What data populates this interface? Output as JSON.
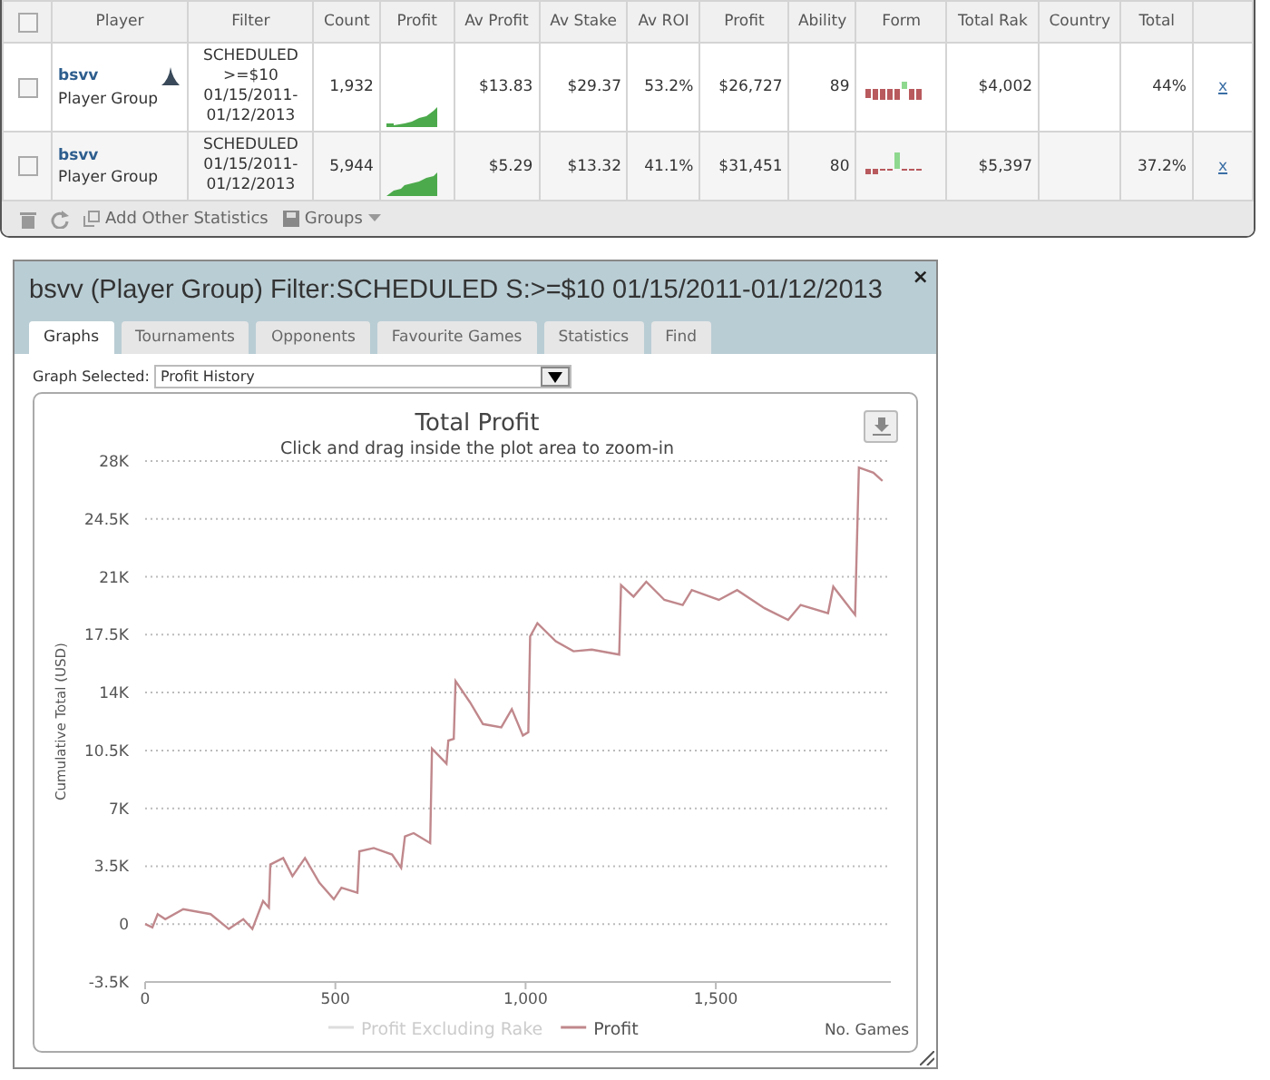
{
  "table": {
    "all_checked": false,
    "columns": [
      "Player",
      "Filter",
      "Count",
      "Profit",
      "Av Profit",
      "Av Stake",
      "Av ROI",
      "Profit",
      "Ability",
      "Form",
      "Total Rak",
      "Country",
      "Total"
    ],
    "rows": [
      {
        "checked": false,
        "player": "bsvv",
        "group": "Player Group",
        "icon_shown": true,
        "filter": "SCHEDULED\n>=$10\n01/15/2011-\n01/12/2013",
        "count": "1,932",
        "av_profit": "$13.83",
        "av_stake": "$29.37",
        "av_roi": "53.2%",
        "profit": "$26,727",
        "ability": "89",
        "total_rake": "$4,002",
        "total": "44%",
        "remove": "x"
      },
      {
        "checked": false,
        "player": "bsvv",
        "group": "Player Group",
        "icon_shown": false,
        "filter": "SCHEDULED\n01/15/2011-\n01/12/2013",
        "count": "5,944",
        "av_profit": "$5.29",
        "av_stake": "$13.32",
        "av_roi": "41.1%",
        "profit": "$31,451",
        "ability": "80",
        "total_rake": "$5,397",
        "total": "37.2%",
        "remove": "x"
      }
    ]
  },
  "toolbar": {
    "add_statistics": "Add Other Statistics",
    "groups": "Groups"
  },
  "dialog": {
    "title": "bsvv (Player Group) Filter:SCHEDULED S:>=$10 01/15/2011-01/12/2013",
    "close": "×",
    "tabs": [
      {
        "label": "Graphs",
        "selected": true
      },
      {
        "label": "Tournaments",
        "selected": false
      },
      {
        "label": "Opponents",
        "selected": false
      },
      {
        "label": "Favourite Games",
        "selected": false
      },
      {
        "label": "Statistics",
        "selected": false
      },
      {
        "label": "Find",
        "selected": false
      }
    ],
    "graph_selected_label": "Graph Selected:",
    "graph_selected_value": "Profit History",
    "chart": {
      "subtitle": "Click and drag inside the plot area to zoom-in",
      "hidden_legend": [
        {
          "label": "Profit Excluding Rake"
        }
      ],
      "chart_data": {
        "type": "line",
        "title": "Total Profit",
        "xlabel": "No. Games",
        "ylabel": "Cumulative Total (USD)",
        "x": [
          0,
          19,
          33,
          53,
          100,
          172,
          220,
          258,
          282,
          310,
          325,
          329,
          363,
          387,
          420,
          458,
          496,
          516,
          558,
          563,
          601,
          649,
          673,
          683,
          706,
          749,
          754,
          792,
          797,
          811,
          816,
          854,
          888,
          936,
          964,
          993,
          1007,
          1012,
          1031,
          1079,
          1126,
          1174,
          1246,
          1251,
          1284,
          1317,
          1365,
          1413,
          1437,
          1508,
          1556,
          1628,
          1690,
          1723,
          1795,
          1809,
          1866,
          1876,
          1914,
          1938
        ],
        "series": [
          {
            "name": "Profit",
            "color": "#c0888c",
            "values": [
              0,
              -200,
              600,
              300,
              900,
              600,
              -300,
              300,
              -300,
              1400,
              1000,
              3600,
              4000,
              2900,
              4000,
              2500,
              1500,
              2200,
              1900,
              4400,
              4600,
              4200,
              3400,
              5300,
              5500,
              4900,
              10600,
              9700,
              11100,
              11200,
              14700,
              13400,
              12100,
              11900,
              13000,
              11400,
              11600,
              17400,
              18200,
              17100,
              16500,
              16600,
              16300,
              20500,
              19800,
              20700,
              19600,
              19300,
              20200,
              19600,
              20200,
              19100,
              18400,
              19300,
              18800,
              20400,
              18700,
              27600,
              27300,
              26800
            ]
          }
        ],
        "grid": true,
        "xlim": [
          0,
          1960
        ],
        "ylim": [
          -3500,
          28000
        ],
        "xticks": [
          0,
          500,
          {
            "value": 1000,
            "label": "1,000"
          },
          {
            "value": 1500,
            "label": "1,500"
          }
        ],
        "yticks": [
          {
            "value": -3500,
            "label": "-3.5K"
          },
          0,
          {
            "value": 3500,
            "label": "3.5K"
          },
          {
            "value": 7000,
            "label": "7K"
          },
          {
            "value": 10500,
            "label": "10.5K"
          },
          {
            "value": 14000,
            "label": "14K"
          },
          {
            "value": 17500,
            "label": "17.5K"
          },
          {
            "value": 21000,
            "label": "21K"
          },
          {
            "value": 24500,
            "label": "24.5K"
          },
          {
            "value": 28000,
            "label": "28K"
          }
        ]
      }
    }
  }
}
